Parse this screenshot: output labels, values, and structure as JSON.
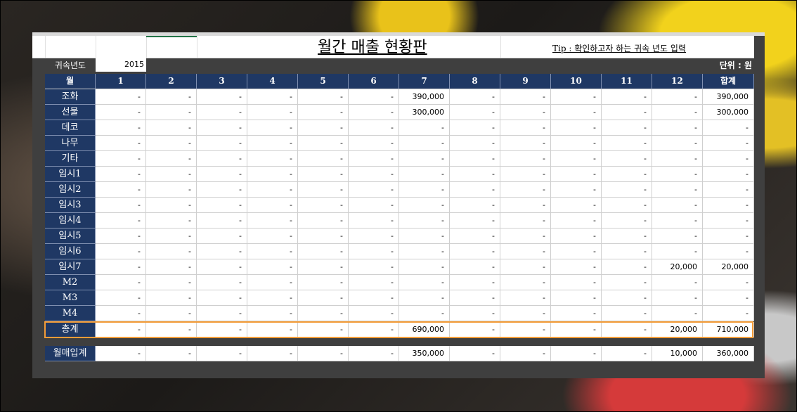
{
  "title": "월간 매출 현황판",
  "tip": "Tip : 확인하고자 하는 귀속 년도 입력",
  "year_label": "귀속년도",
  "year_value": "2015",
  "unit": "단위 : 원",
  "header": [
    "월",
    "1",
    "2",
    "3",
    "4",
    "5",
    "6",
    "7",
    "8",
    "9",
    "10",
    "11",
    "12",
    "합계"
  ],
  "rows": [
    {
      "label": "조화",
      "values": [
        "-",
        "-",
        "-",
        "-",
        "-",
        "-",
        "390,000",
        "-",
        "-",
        "-",
        "-",
        "-",
        "390,000"
      ]
    },
    {
      "label": "선물",
      "values": [
        "-",
        "-",
        "-",
        "-",
        "-",
        "-",
        "300,000",
        "-",
        "-",
        "-",
        "-",
        "-",
        "300,000"
      ]
    },
    {
      "label": "데코",
      "values": [
        "-",
        "-",
        "-",
        "-",
        "-",
        "-",
        "-",
        "-",
        "-",
        "-",
        "-",
        "-",
        "-"
      ]
    },
    {
      "label": "나무",
      "values": [
        "-",
        "-",
        "-",
        "-",
        "-",
        "-",
        "-",
        "-",
        "-",
        "-",
        "-",
        "-",
        "-"
      ]
    },
    {
      "label": "기타",
      "values": [
        "-",
        "-",
        "-",
        "-",
        "-",
        "-",
        "-",
        "-",
        "-",
        "-",
        "-",
        "-",
        "-"
      ]
    },
    {
      "label": "임시1",
      "values": [
        "-",
        "-",
        "-",
        "-",
        "-",
        "-",
        "-",
        "-",
        "-",
        "-",
        "-",
        "-",
        "-"
      ]
    },
    {
      "label": "임시2",
      "values": [
        "-",
        "-",
        "-",
        "-",
        "-",
        "-",
        "-",
        "-",
        "-",
        "-",
        "-",
        "-",
        "-"
      ]
    },
    {
      "label": "임시3",
      "values": [
        "-",
        "-",
        "-",
        "-",
        "-",
        "-",
        "-",
        "-",
        "-",
        "-",
        "-",
        "-",
        "-"
      ]
    },
    {
      "label": "임시4",
      "values": [
        "-",
        "-",
        "-",
        "-",
        "-",
        "-",
        "-",
        "-",
        "-",
        "-",
        "-",
        "-",
        "-"
      ]
    },
    {
      "label": "임시5",
      "values": [
        "-",
        "-",
        "-",
        "-",
        "-",
        "-",
        "-",
        "-",
        "-",
        "-",
        "-",
        "-",
        "-"
      ]
    },
    {
      "label": "임시6",
      "values": [
        "-",
        "-",
        "-",
        "-",
        "-",
        "-",
        "-",
        "-",
        "-",
        "-",
        "-",
        "-",
        "-"
      ]
    },
    {
      "label": "임시7",
      "values": [
        "-",
        "-",
        "-",
        "-",
        "-",
        "-",
        "-",
        "-",
        "-",
        "-",
        "-",
        "20,000",
        "20,000"
      ]
    },
    {
      "label": "M2",
      "values": [
        "-",
        "-",
        "-",
        "-",
        "-",
        "-",
        "-",
        "-",
        "-",
        "-",
        "-",
        "-",
        "-"
      ]
    },
    {
      "label": "M3",
      "values": [
        "-",
        "-",
        "-",
        "-",
        "-",
        "-",
        "-",
        "-",
        "-",
        "-",
        "-",
        "-",
        "-"
      ]
    },
    {
      "label": "M4",
      "values": [
        "-",
        "-",
        "-",
        "-",
        "-",
        "-",
        "-",
        "-",
        "-",
        "-",
        "-",
        "-",
        "-"
      ]
    }
  ],
  "total_row": {
    "label": "총계",
    "values": [
      "-",
      "-",
      "-",
      "-",
      "-",
      "-",
      "690,000",
      "-",
      "-",
      "-",
      "-",
      "20,000",
      "710,000"
    ]
  },
  "purchase_row": {
    "label": "월매입계",
    "values": [
      "-",
      "-",
      "-",
      "-",
      "-",
      "-",
      "350,000",
      "-",
      "-",
      "-",
      "-",
      "10,000",
      "360,000"
    ]
  },
  "colors": {
    "header_bg": "#1f3864",
    "highlight": "#f39c38",
    "sheet_bg": "#3f3f3f",
    "selection": "#217346"
  }
}
